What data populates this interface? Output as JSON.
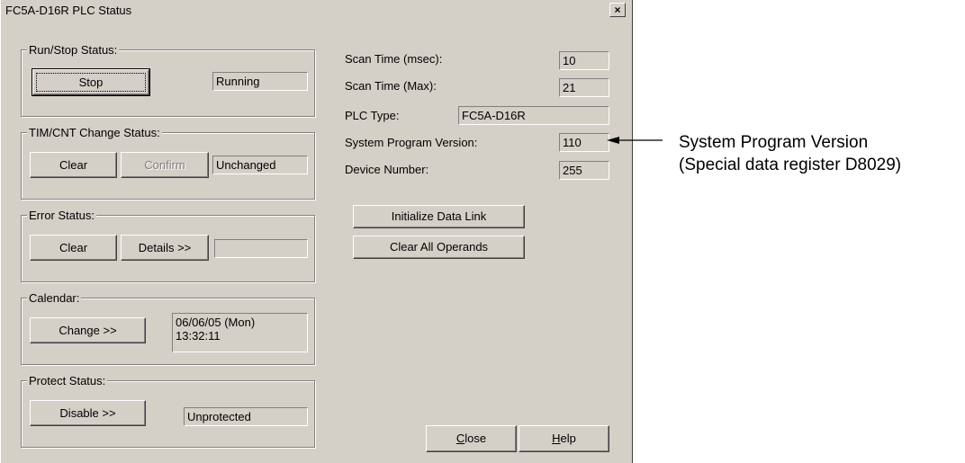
{
  "window": {
    "title": "FC5A-D16R PLC Status",
    "close_glyph": "×"
  },
  "run_stop": {
    "legend": "Run/Stop Status:",
    "button": "Stop",
    "status": "Running"
  },
  "timcnt": {
    "legend": "TIM/CNT Change Status:",
    "clear": "Clear",
    "confirm": "Confirm",
    "status": "Unchanged"
  },
  "error": {
    "legend": "Error Status:",
    "clear": "Clear",
    "details": "Details >>",
    "status": ""
  },
  "calendar": {
    "legend": "Calendar:",
    "change": "Change >>",
    "date": "06/06/05 (Mon)",
    "time": "13:32:11"
  },
  "protect": {
    "legend": "Protect Status:",
    "disable": "Disable >>",
    "status": "Unprotected"
  },
  "info": {
    "scan_time_label": "Scan Time (msec):",
    "scan_time_value": "10",
    "scan_max_label": "Scan Time (Max):",
    "scan_max_value": "21",
    "plc_type_label": "PLC Type:",
    "plc_type_value": "FC5A-D16R",
    "sys_prog_label": "System Program Version:",
    "sys_prog_value": "110",
    "device_label": "Device Number:",
    "device_value": "255"
  },
  "actions": {
    "init_link": "Initialize Data Link",
    "clear_operands": "Clear All Operands"
  },
  "footer": {
    "close_mnemonic": "C",
    "close_rest": "lose",
    "help_mnemonic": "H",
    "help_rest": "elp"
  },
  "annotation": {
    "line1": "System Program Version",
    "line2": "(Special data register D8029)"
  }
}
